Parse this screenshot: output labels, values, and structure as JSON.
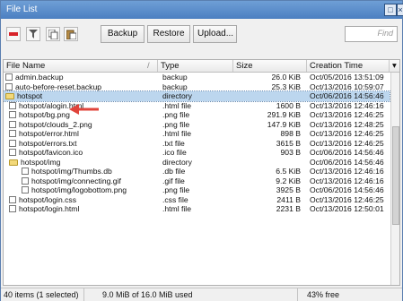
{
  "window": {
    "title": "File List"
  },
  "toolbar": {
    "upload_label": "Backup",
    "restore_label": "Restore",
    "uploadfile_label": "Upload...",
    "find_placeholder": "Find"
  },
  "columns": [
    "File Name",
    "Type",
    "Size",
    "Creation Time"
  ],
  "rows": [
    {
      "name": "admin.backup",
      "type": "backup",
      "size": "26.0 KiB",
      "time": "Oct/05/2016 13:51:09",
      "kind": "file"
    },
    {
      "name": "auto-before-reset.backup",
      "type": "backup",
      "size": "25.3 KiB",
      "time": "Oct/13/2016 10:59:07",
      "kind": "file"
    },
    {
      "name": "hotspot",
      "type": "directory",
      "size": "",
      "time": "Oct/06/2016 14:56:46",
      "kind": "dir",
      "selected": true
    },
    {
      "name": "hotspot/alogin.html",
      "type": ".html file",
      "size": "1600 B",
      "time": "Oct/13/2016 12:46:16",
      "kind": "file"
    },
    {
      "name": "hotspot/bg.png",
      "type": ".png file",
      "size": "291.9 KiB",
      "time": "Oct/13/2016 12:46:25",
      "kind": "file"
    },
    {
      "name": "hotspot/clouds_2.png",
      "type": ".png file",
      "size": "147.9 KiB",
      "time": "Oct/13/2016 12:48:25",
      "kind": "file"
    },
    {
      "name": "hotspot/error.html",
      "type": ".html file",
      "size": "898 B",
      "time": "Oct/13/2016 12:46:25",
      "kind": "file"
    },
    {
      "name": "hotspot/errors.txt",
      "type": ".txt file",
      "size": "3615 B",
      "time": "Oct/13/2016 12:46:25",
      "kind": "file"
    },
    {
      "name": "hotspot/favicon.ico",
      "type": ".ico file",
      "size": "903 B",
      "time": "Oct/06/2016 14:56:46",
      "kind": "file"
    },
    {
      "name": "hotspot/img",
      "type": "directory",
      "size": "",
      "time": "Oct/06/2016 14:56:46",
      "kind": "dir"
    },
    {
      "name": "hotspot/img/Thumbs.db",
      "type": ".db file",
      "size": "6.5 KiB",
      "time": "Oct/13/2016 12:46:16",
      "kind": "file",
      "indent": true
    },
    {
      "name": "hotspot/img/connecting.gif",
      "type": ".gif file",
      "size": "9.2 KiB",
      "time": "Oct/13/2016 12:46:16",
      "kind": "file",
      "indent": true
    },
    {
      "name": "hotspot/img/logobottom.png",
      "type": ".png file",
      "size": "3925 B",
      "time": "Oct/06/2016 14:56:46",
      "kind": "file",
      "indent": true
    },
    {
      "name": "hotspot/login.css",
      "type": ".css file",
      "size": "2411 B",
      "time": "Oct/13/2016 12:46:25",
      "kind": "file"
    },
    {
      "name": "hotspot/login.html",
      "type": ".html file",
      "size": "2231 B",
      "time": "Oct/13/2016 12:50:01",
      "kind": "file"
    }
  ],
  "status": {
    "items": "40 items (1 selected)",
    "usage": "9.0 MiB of 16.0 MiB used",
    "free": "43% free"
  },
  "colors": {
    "titlebar": "#5a8ccb",
    "selected_row": "#bcd6ee",
    "delete_icon": "#d8242a",
    "arrow": "#e0443b"
  }
}
